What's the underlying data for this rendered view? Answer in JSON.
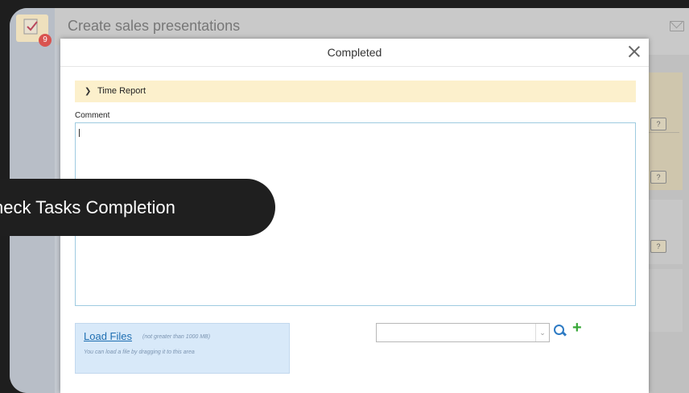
{
  "header": {
    "title": "Create sales presentations",
    "badge_count": "9"
  },
  "modal": {
    "title": "Completed",
    "time_report_label": "Time Report",
    "comment_label": "Comment",
    "comment_value": "",
    "load_files_label": "Load Files",
    "load_files_size_note": "(not greater than 1000 MB)",
    "load_files_drag_note": "You can load a file by dragging it to this area",
    "select_value": ""
  },
  "banner": {
    "text": "heck Tasks Completion"
  },
  "right_panel": {
    "help_label": "?"
  },
  "colors": {
    "accent": "#2e7bc4",
    "add_green": "#38a838",
    "time_report_bg": "#fcf0cc",
    "dropzone_bg": "#d8e9f9",
    "badge_red": "#d9534f"
  },
  "icons": [
    "task-check-icon",
    "mail-icon",
    "close-icon",
    "chevron-right-icon",
    "search-icon",
    "plus-icon",
    "help-bubble-icon",
    "select-arrow-icon"
  ]
}
